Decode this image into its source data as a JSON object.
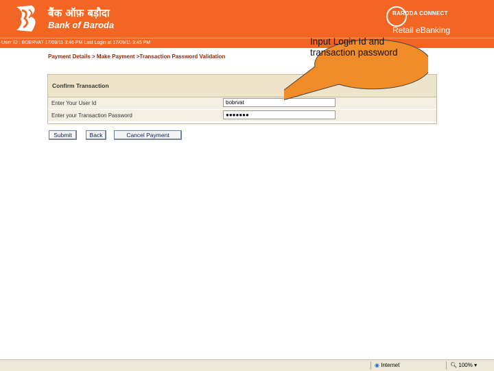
{
  "header": {
    "bank_name_hindi": "बैंक ऑफ़ बड़ौदा",
    "bank_name": "Bank of Baroda",
    "brand_top": "BARODA CONNECT",
    "brand_bottom": "Retail eBanking",
    "brand_color": "#f26522"
  },
  "user_bar": {
    "text": "User ID : BOBRVAT 17/09/11 3:46 PM Last Login at 17/09/11 3:45 PM"
  },
  "breadcrumb": "Payment Details > Make Payment >Transaction Password Validation",
  "confirm": {
    "title": "Confirm Transaction",
    "user_id_label": "Enter Your User Id",
    "user_id_value": "bobrvat",
    "password_label": "Enter your Transaction Password",
    "password_value": "●●●●●●●"
  },
  "buttons": {
    "submit": "Submit",
    "back": "Back",
    "cancel": "Cancel Payment"
  },
  "callout": {
    "text": "Input Login Id and transaction password",
    "color": "#f28c28"
  },
  "statusbar": {
    "zone": "Internet",
    "zoom": "100%"
  }
}
